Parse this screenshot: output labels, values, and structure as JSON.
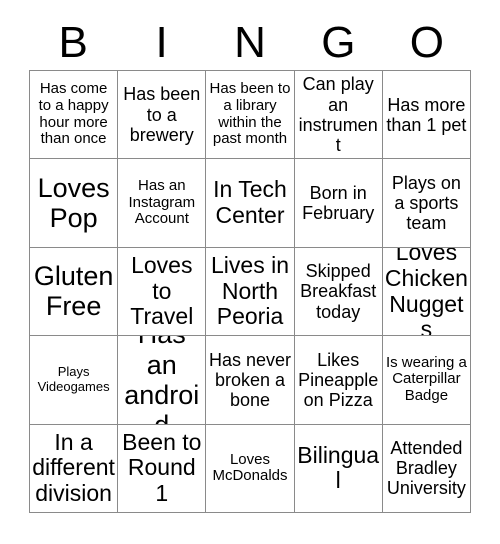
{
  "card": {
    "header_letters": [
      "B",
      "I",
      "N",
      "G",
      "O"
    ],
    "columns": 5,
    "rows": 5,
    "grid_line_color": "#8a8a8a",
    "background_color": "#ffffff",
    "text_color": "#000000",
    "squares": [
      [
        {
          "text": "Has come to a happy hour more than once",
          "size": "sm"
        },
        {
          "text": "Has been to a brewery",
          "size": "md"
        },
        {
          "text": "Has been to a library within the past month",
          "size": "sm"
        },
        {
          "text": "Can play an instrument",
          "size": "md"
        },
        {
          "text": "Has more than 1 pet",
          "size": "md"
        }
      ],
      [
        {
          "text": "Loves Pop",
          "size": "xl"
        },
        {
          "text": "Has an Instagram Account",
          "size": "sm"
        },
        {
          "text": "In Tech Center",
          "size": "lg"
        },
        {
          "text": "Born in February",
          "size": "md"
        },
        {
          "text": "Plays on a sports team",
          "size": "md"
        }
      ],
      [
        {
          "text": "Gluten Free",
          "size": "xl"
        },
        {
          "text": "Loves to Travel",
          "size": "lg"
        },
        {
          "text": "Lives in North Peoria",
          "size": "lg"
        },
        {
          "text": "Skipped Breakfast today",
          "size": "md"
        },
        {
          "text": "Loves Chicken Nuggets",
          "size": "lg"
        }
      ],
      [
        {
          "text": "Plays Videogames",
          "size": "xs"
        },
        {
          "text": "Has an android",
          "size": "xl"
        },
        {
          "text": "Has never broken a bone",
          "size": "md"
        },
        {
          "text": "Likes Pineapple on Pizza",
          "size": "md"
        },
        {
          "text": "Is wearing a Caterpillar Badge",
          "size": "sm"
        }
      ],
      [
        {
          "text": "In a different division",
          "size": "lg"
        },
        {
          "text": "Been to Round 1",
          "size": "lg"
        },
        {
          "text": "Loves McDonalds",
          "size": "sm"
        },
        {
          "text": "Bilingual",
          "size": "lg"
        },
        {
          "text": "Attended Bradley University",
          "size": "md"
        }
      ]
    ]
  }
}
